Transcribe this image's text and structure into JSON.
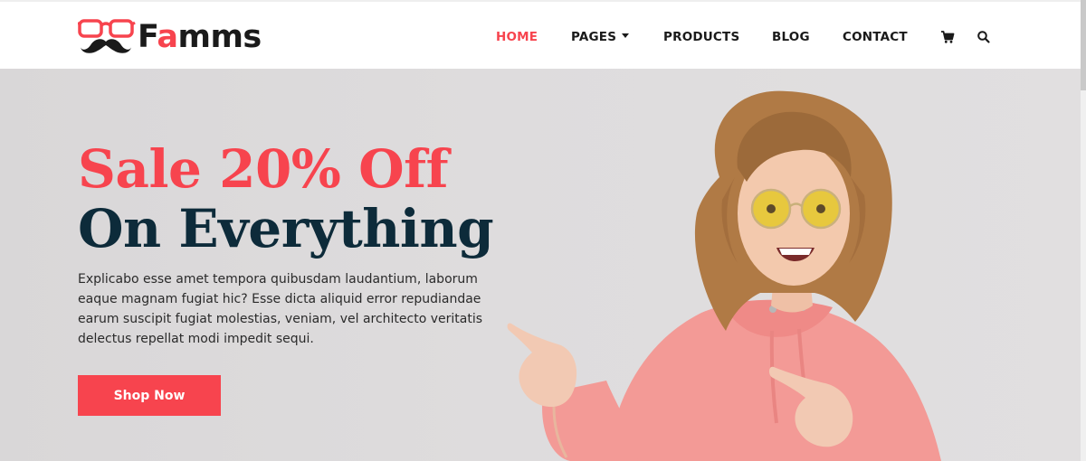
{
  "brand": {
    "name_start": "F",
    "name_accent": "a",
    "name_end": "mms",
    "accent_color": "#f7444e"
  },
  "nav": {
    "items": [
      {
        "label": "HOME",
        "active": true
      },
      {
        "label": "PAGES",
        "dropdown": true
      },
      {
        "label": "PRODUCTS"
      },
      {
        "label": "BLOG"
      },
      {
        "label": "CONTACT"
      }
    ],
    "cart_icon": "cart-icon",
    "search_icon": "search-icon"
  },
  "hero": {
    "headline_line1": "Sale 20% Off",
    "headline_line2": "On Everything",
    "description": "Explicabo esse amet tempora quibusdam laudantium, laborum eaque magnam fugiat hic? Esse dicta aliquid error repudiandae earum suscipit fugiat molestias, veniam, vel architecto veritatis delectus repellat modi impedit sequi.",
    "cta_label": "Shop Now",
    "headline_color_1": "#f7444e",
    "headline_color_2": "#0d2b3a"
  }
}
